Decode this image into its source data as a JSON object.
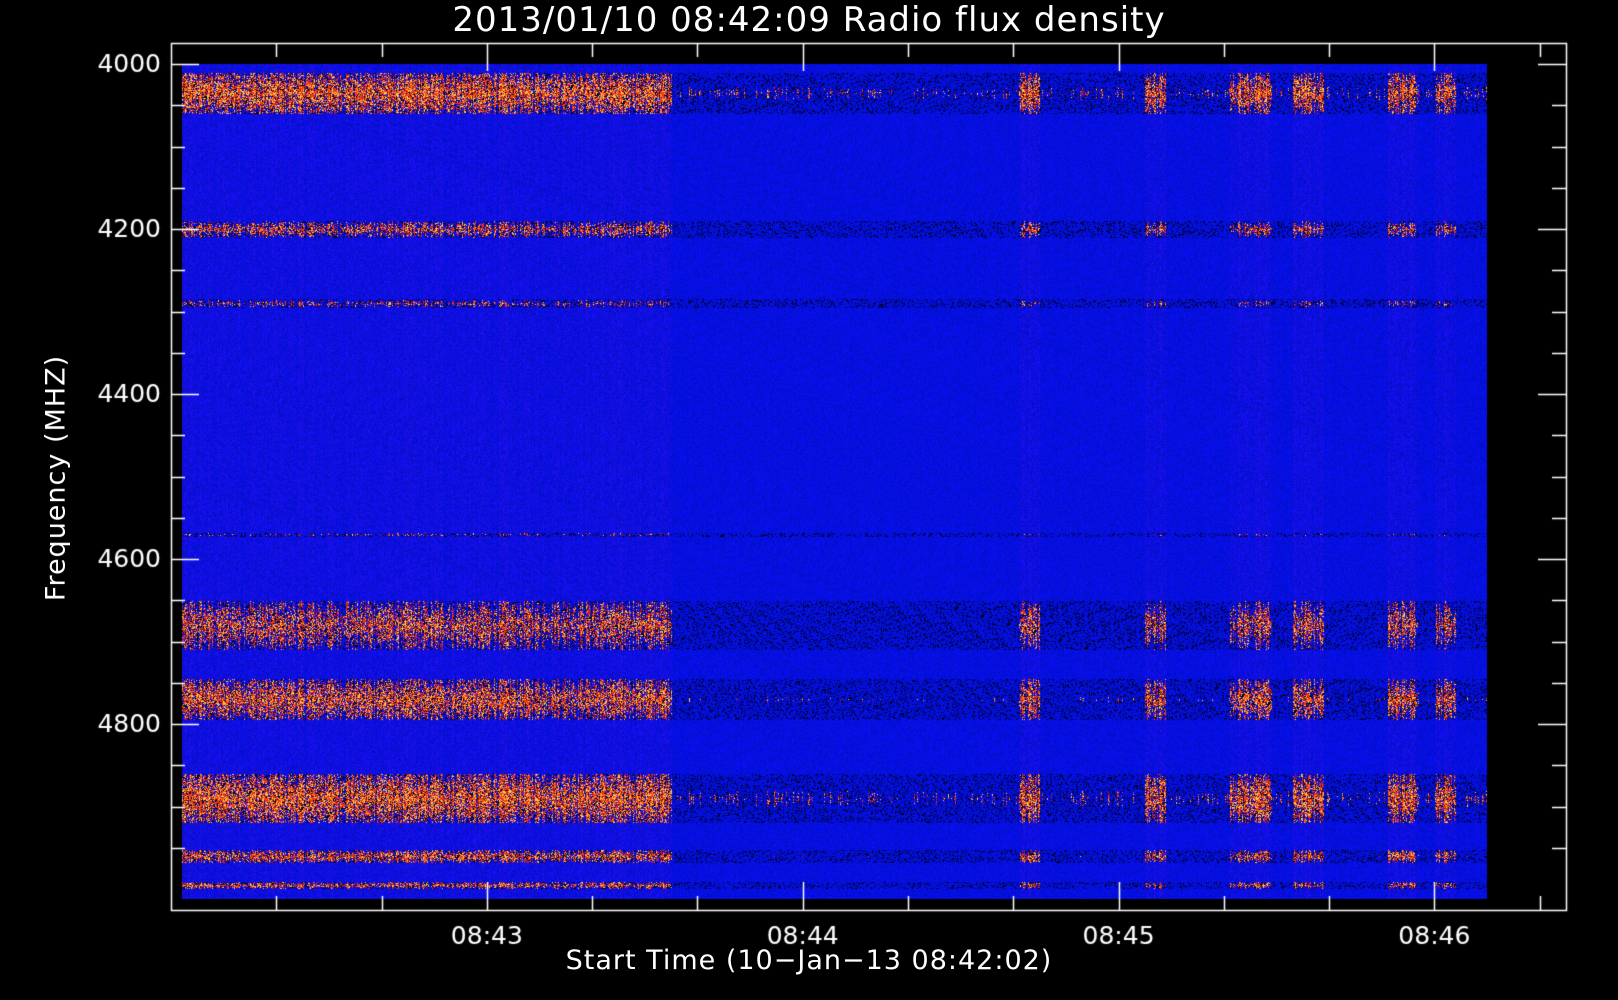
{
  "chart_data": {
    "type": "heatmap",
    "title": "2013/01/10 08:42:09 Radio flux density",
    "xlabel": "Start Time (10−Jan−13 08:42:02)",
    "ylabel": "Frequency (MHZ)",
    "x_tick_labels": [
      "08:43",
      "08:44",
      "08:45",
      "08:46"
    ],
    "x_tick_seconds": [
      180,
      240,
      300,
      360
    ],
    "x_minor_tick_seconds": [
      140,
      160,
      180,
      200,
      220,
      240,
      260,
      280,
      300,
      320,
      340,
      360,
      380
    ],
    "y_tick_labels": [
      "4000",
      "4200",
      "4400",
      "4600",
      "4800"
    ],
    "y_tick_values": [
      4000,
      4200,
      4400,
      4600,
      4800
    ],
    "y_minor_tick_values": [
      4000,
      4050,
      4100,
      4150,
      4200,
      4250,
      4300,
      4350,
      4400,
      4450,
      4500,
      4550,
      4600,
      4650,
      4700,
      4750,
      4800,
      4850,
      4900,
      4950
    ],
    "xlim_seconds_after_0840": [
      120,
      385
    ],
    "ylim_MHz": [
      4000,
      5025
    ],
    "data_time_range_seconds_after_0840": [
      122,
      370
    ],
    "data_freq_range_MHz": [
      4000,
      5000
    ],
    "colormap": [
      "#000000",
      "#2a10ff",
      "#ff2a00",
      "#ffd060"
    ],
    "bands_MHz": [
      {
        "center": 4035,
        "halfwidth": 25,
        "strength": 1.0
      },
      {
        "center": 4200,
        "halfwidth": 10,
        "strength": 0.75
      },
      {
        "center": 4290,
        "halfwidth": 6,
        "strength": 0.55
      },
      {
        "center": 4570,
        "halfwidth": 4,
        "strength": 0.45
      },
      {
        "center": 4680,
        "halfwidth": 30,
        "strength": 0.8
      },
      {
        "center": 4770,
        "halfwidth": 25,
        "strength": 0.9
      },
      {
        "center": 4890,
        "halfwidth": 30,
        "strength": 1.0
      },
      {
        "center": 4960,
        "halfwidth": 8,
        "strength": 0.85
      },
      {
        "center": 4995,
        "halfwidth": 4,
        "strength": 0.8
      }
    ]
  }
}
